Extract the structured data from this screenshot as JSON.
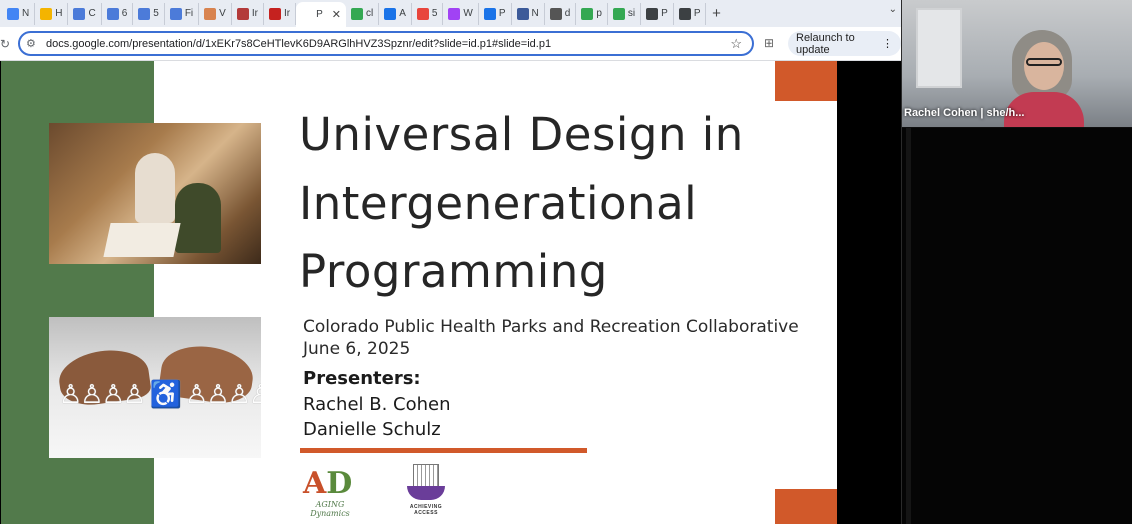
{
  "browser": {
    "tabs": [
      {
        "label": "N",
        "color": "#4285f4"
      },
      {
        "label": "H",
        "color": "#f4b400"
      },
      {
        "label": "C",
        "color": "#4c7bd9"
      },
      {
        "label": "6",
        "color": "#4c7bd9"
      },
      {
        "label": "5",
        "color": "#4c7bd9"
      },
      {
        "label": "Fi",
        "color": "#4c7bd9"
      },
      {
        "label": "V",
        "color": "#d8834f"
      },
      {
        "label": "Ir",
        "color": "#b33a3a"
      },
      {
        "label": "Ir",
        "color": "#c5221f"
      },
      {
        "label": "P",
        "color": "#ffffff",
        "active": true
      },
      {
        "label": "cl",
        "color": "#34a853"
      },
      {
        "label": "A",
        "color": "#1a73e8"
      },
      {
        "label": "5",
        "color": "#e8453c"
      },
      {
        "label": "W",
        "color": "#a142f4"
      },
      {
        "label": "P",
        "color": "#1a73e8"
      },
      {
        "label": "N",
        "color": "#3c5a99"
      },
      {
        "label": "d",
        "color": "#555555"
      },
      {
        "label": "p",
        "color": "#34a853"
      },
      {
        "label": "si",
        "color": "#34a853"
      },
      {
        "label": "P",
        "color": "#3c4043"
      },
      {
        "label": "P",
        "color": "#3c4043"
      }
    ],
    "new_tab": "+",
    "tab_menu": "⌄",
    "url": "docs.google.com/presentation/d/1xEKr7s8CeHTlevK6D9ARGlhHVZ3Spznr/edit?slide=id.p1#slide=id.p1",
    "relaunch_label": "Relaunch to update",
    "accent": "#3b6fd4"
  },
  "slide": {
    "title": "Universal Design in Intergenerational Programming",
    "organization": "Colorado Public Health Parks and Recreation Collaborative",
    "date": "June 6, 2025",
    "presenters_heading": "Presenters:",
    "presenters": [
      "Rachel B. Cohen",
      "Danielle Schulz"
    ],
    "logo_left_mark": "AD",
    "logo_left_caption": "AGING Dynamics",
    "logo_right_caption": "ACHIEVING ACCESS",
    "colors": {
      "green": "#527a4b",
      "orange": "#d1592a"
    }
  },
  "meeting": {
    "participant_name": "Rachel Cohen | she/h..."
  }
}
